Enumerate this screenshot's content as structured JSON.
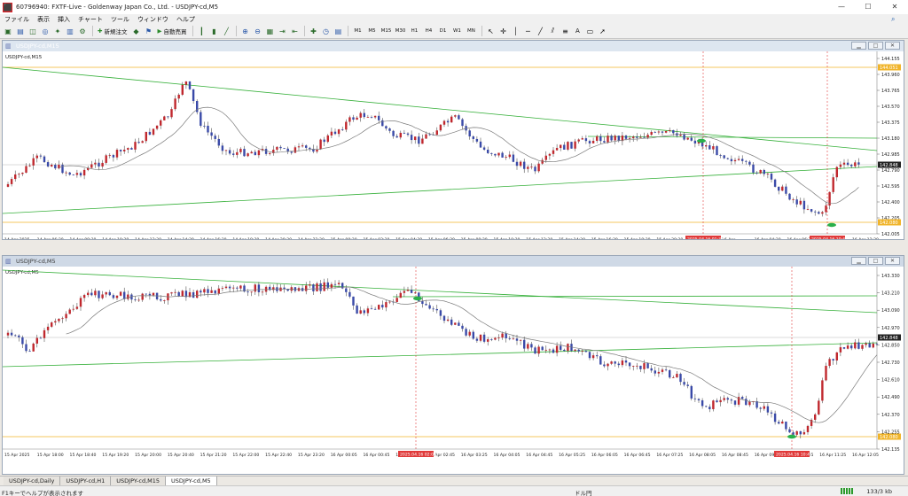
{
  "window": {
    "title": "60796940: FXTF-Live - Goldenway Japan Co., Ltd. - USDJPY-cd,M5",
    "app_icon": "metatrader-icon"
  },
  "menu": [
    "ファイル",
    "表示",
    "挿入",
    "チャート",
    "ツール",
    "ウィンドウ",
    "ヘルプ"
  ],
  "toolbar": {
    "new_order": "新規注文",
    "auto_trading": "自動売買",
    "timeframes": [
      "M1",
      "M5",
      "M15",
      "M30",
      "H1",
      "H4",
      "D1",
      "W1",
      "MN"
    ]
  },
  "charts": [
    {
      "title": "USDJPY-cd,M15",
      "label": "USDJPY-cd,M15",
      "price_ticks": [
        "144.155",
        "143.960",
        "143.765",
        "143.570",
        "143.375",
        "143.180",
        "142.985",
        "142.790",
        "142.595",
        "142.400",
        "142.205",
        "142.005"
      ],
      "current_price": "142.848",
      "orange_top_label": "144.051",
      "orange_bottom_label": "142.080",
      "time_labels": [
        "14 Apr 2025",
        "14 Apr 06:30",
        "14 Apr 08:30",
        "14 Apr 10:30",
        "14 Apr 12:30",
        "14 Apr 14:30",
        "14 Apr 16:30",
        "14 Apr 18:30",
        "14 Apr 20:30",
        "14 Apr 22:30",
        "15 Apr 00:30",
        "15 Apr 02:30",
        "15 Apr 04:30",
        "15 Apr 06:30",
        "15 Apr 08:30",
        "15 Apr 10:30",
        "15 Apr 12:30",
        "15 Apr 14:30",
        "15 Apr 16:30",
        "15 Apr 18:30",
        "15 Apr 20:30",
        "15 Apr 22:30",
        "16 Apr",
        "16 Apr 04:30",
        "16 Apr 06:30",
        "16 Apr",
        "16 Apr 12:30"
      ],
      "vline_labels": [
        "2025.04.16 01:30",
        "2025.04.16 10:45"
      ]
    },
    {
      "title": "USDJPY-cd,M5",
      "label": "USDJPY-cd,M5",
      "price_ticks": [
        "143.330",
        "143.210",
        "143.090",
        "142.970",
        "142.850",
        "142.730",
        "142.610",
        "142.490",
        "142.370",
        "142.255",
        "142.135"
      ],
      "current_price": "142.848",
      "orange_bottom_label": "142.080",
      "time_labels": [
        "15 Apr 2025",
        "15 Apr 18:00",
        "15 Apr 18:40",
        "15 Apr 19:20",
        "15 Apr 20:00",
        "15 Apr 20:40",
        "15 Apr 21:20",
        "15 Apr 22:00",
        "15 Apr 22:40",
        "15 Apr 23:20",
        "16 Apr 00:05",
        "16 Apr 00:45",
        "16 Apr 01:25",
        "16 Apr 02:45",
        "16 Apr 03:25",
        "16 Apr 04:05",
        "16 Apr 04:45",
        "16 Apr 05:25",
        "16 Apr 06:05",
        "16 Apr 06:45",
        "16 Apr 07:25",
        "16 Apr 08:05",
        "16 Apr 08:45",
        "16 Apr 09:25",
        "16 Apr 10:05",
        "16 Apr 11:25",
        "16 Apr 12:05"
      ],
      "vline_labels": [
        "2025.04.16 02:05",
        "2025.04.16 10:45"
      ]
    }
  ],
  "tabs": [
    "USDJPY-cd,Daily",
    "USDJPY-cd,H1",
    "USDJPY-cd,M15",
    "USDJPY-cd,M5"
  ],
  "status": {
    "hint": "F1キーでヘルプが表示されます",
    "profile": "ドル円",
    "network": "133/3 kb"
  },
  "colors": {
    "bull_candle": "#c0282e",
    "bear_candle": "#3a4aa8",
    "moving_average": "#7a7a7a",
    "trendline": "#36b03a",
    "level_line": "#f0b42a",
    "vline": "#e03a3a",
    "marker": "#2ab04a"
  }
}
